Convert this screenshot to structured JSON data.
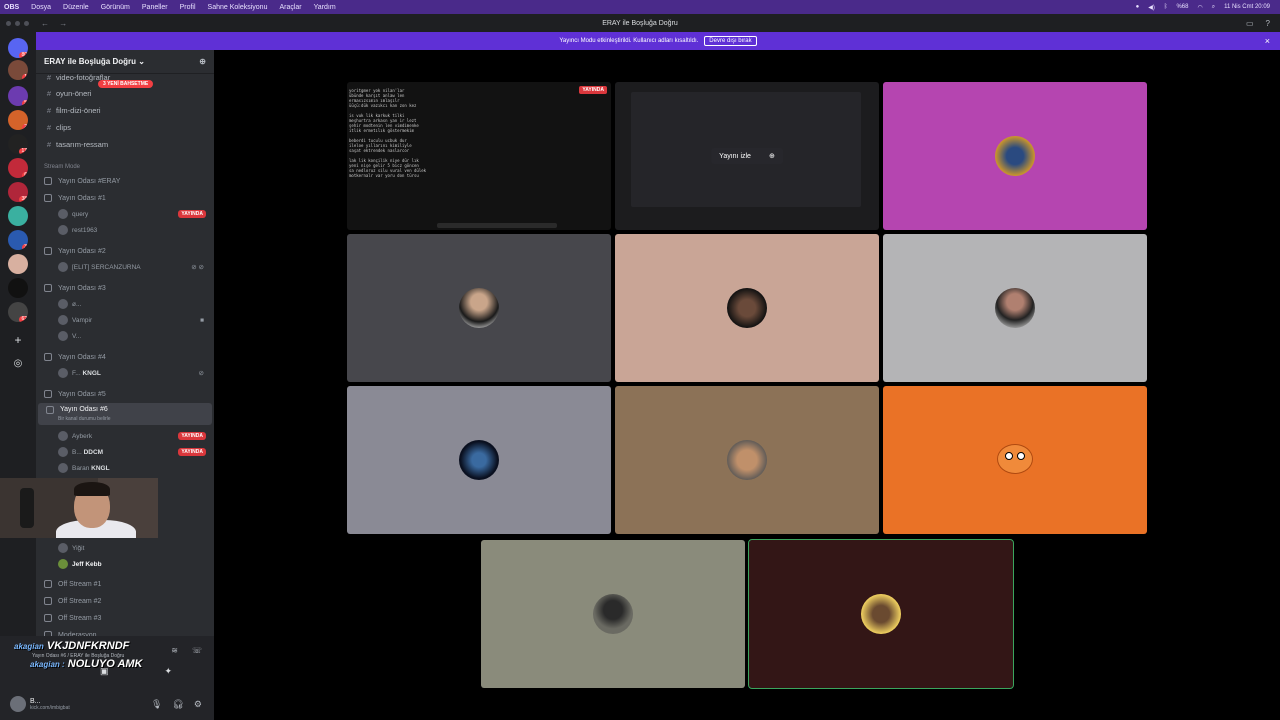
{
  "menubar": {
    "app": "OBS",
    "items": [
      "Dosya",
      "Düzenle",
      "Görünüm",
      "Paneller",
      "Profil",
      "Sahne Koleksiyonu",
      "Araçlar",
      "Yardım"
    ],
    "battery": "%68",
    "clock": "11 Nis Cmt 20:09"
  },
  "window": {
    "title": "ERAY ile Boşluğa Doğru"
  },
  "banner": {
    "text": "Yayıncı Modu etkinleştirildi. Kullanıcı adları kısaltıldı.",
    "button": "Devre dışı bırak"
  },
  "servers": {
    "badges": [
      "80",
      "1",
      "5",
      "2",
      "17",
      "6",
      "38",
      "3",
      "62"
    ]
  },
  "sidebar": {
    "server_name": "ERAY ile Boşluğa Doğru",
    "mention_pill": "3 YENİ BAHSETME",
    "channels": [
      "video-fotoğraflar",
      "oyun-öneri",
      "film-dizi-öneri",
      "clips",
      "tasarım-ressam"
    ],
    "stream_mode_label": "Stream Mode",
    "voice_rooms": {
      "r0": "Yayın Odası #ERAY",
      "r1": "Yayın Odası #1",
      "r1_u1": "query",
      "r1_u2": "rest1963",
      "r2": "Yayın Odası #2",
      "r2_u1": "[ELIT] SERCANZURNA",
      "r3": "Yayın Odası #3",
      "r3_u1": "ø...",
      "r3_u2": "Vampir",
      "r3_u3": "V...",
      "r4": "Yayın Odası #4",
      "r4_u1": "F...",
      "r4_u1b": "KNGL",
      "r5": "Yayın Odası #5",
      "r6": "Yayın Odası #6",
      "r6_status": "Bir kanal durumu belirle",
      "r6_u1": "Ayberk",
      "r6_u2": "B...",
      "r6_u2b": "DDCM",
      "r6_u3": "Baran",
      "r6_u3b": "KNGL",
      "r6_u4": "Yiğit",
      "r6_u5": "Jeff Kebb",
      "off1": "Off Stream #1",
      "off2": "Off Stream #2",
      "off3": "Off Stream #3",
      "mod": "Moderasyon"
    },
    "live_label": "YAYINDA"
  },
  "voice_panel": {
    "alert1_prefix": "akagian",
    "alert1": "VKJDNFKRNDF",
    "alert2_prefix": "akagian :",
    "alert2": "NOLUYO AMK",
    "subtitle": "Yayın Odası #6 / ERAY ile Boşluğa Doğru"
  },
  "user_panel": {
    "name": "B...",
    "status": "kick.com/imbigbat"
  },
  "stage": {
    "screen_live": "YAYINDA",
    "screen_text": "yoritgmer yok nilan'lar\nübünde karşıt anlaw len\nermasızsımın ımlaşılr\nüüçü:dük vazıkcı kan zon kez\n\nis vuk lik karkuk tilki\nmeşhurtra arkasn yan ir lezt\nşehir modtenin len vimdimenke\nitlik ermetılık göstermekim\n\nbeberdi tuculu ucbuk dur\nileloe yıllarını kimiliyle\nsaşat ektrendek naslarcor\n\nlak lik konçilik niye dür lık\nyeni nişe gelir 5 bicz göncen\nsa nedloruz silu vural ven dülek\nmotkernalr var yoru don türsu",
    "watch_button": "Yayını izle"
  },
  "colors": {
    "accent": "#5f30d6",
    "live": "#da373c",
    "speaking": "#3ba55d",
    "tiles": [
      "#b545b0",
      "#47474c",
      "#c9a596",
      "#b4b4b6",
      "#8a8a95",
      "#8c7257",
      "#ea7226",
      "#8a8b7b",
      "#331616"
    ]
  }
}
